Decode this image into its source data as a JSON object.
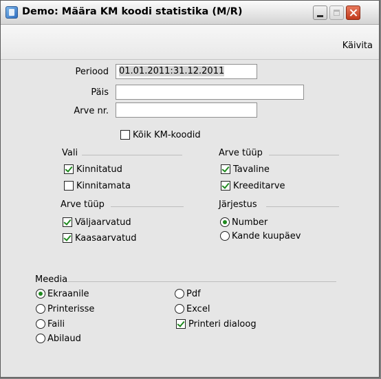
{
  "window": {
    "title": "Demo: Määra KM koodi statistika (M/R)"
  },
  "toolbar": {
    "run_label": "Käivita"
  },
  "form": {
    "period_label": "Periood",
    "period_value": "01.01.2011:31.12.2011",
    "header_label": "Päis",
    "header_value": "",
    "invoice_no_label": "Arve nr.",
    "invoice_no_value": "",
    "all_codes_label": "Kõik KM-koodid",
    "all_codes_checked": false
  },
  "vali": {
    "heading": "Vali",
    "items": [
      {
        "label": "Kinnitatud",
        "checked": true
      },
      {
        "label": "Kinnitamata",
        "checked": false
      }
    ]
  },
  "arve_tyyp_right": {
    "heading": "Arve tüüp",
    "items": [
      {
        "label": "Tavaline",
        "checked": true
      },
      {
        "label": "Kreeditarve",
        "checked": true
      }
    ]
  },
  "arve_tyyp_left": {
    "heading": "Arve tüüp",
    "items": [
      {
        "label": "Väljaarvatud",
        "checked": true
      },
      {
        "label": "Kaasaarvatud",
        "checked": true
      }
    ]
  },
  "sort": {
    "heading": "Järjestus",
    "options": [
      {
        "label": "Number",
        "selected": true
      },
      {
        "label": "Kande kuupäev",
        "selected": false
      }
    ]
  },
  "media": {
    "heading": "Meedia",
    "left_options": [
      {
        "label": "Ekraanile",
        "selected": true
      },
      {
        "label": "Printerisse",
        "selected": false
      },
      {
        "label": "Faili",
        "selected": false
      },
      {
        "label": "Abilaud",
        "selected": false
      }
    ],
    "right_options": [
      {
        "label": "Pdf",
        "selected": false
      },
      {
        "label": "Excel",
        "selected": false
      }
    ],
    "printer_dialog_label": "Printeri dialoog",
    "printer_dialog_checked": true
  },
  "colors": {
    "check_green": "#1f8a1f",
    "window_bg": "#e6e6e6",
    "close_red": "#c0391b"
  }
}
